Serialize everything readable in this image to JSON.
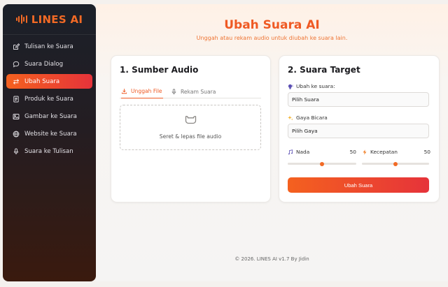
{
  "app": {
    "brand": "LINES AI",
    "accent": "#ef5a24"
  },
  "sidebar": {
    "items": [
      {
        "label": "Tulisan ke Suara",
        "icon": "edit-icon",
        "active": false
      },
      {
        "label": "Suara Dialog",
        "icon": "chat-bubble-icon",
        "active": false
      },
      {
        "label": "Ubah Suara",
        "icon": "swap-icon",
        "active": true
      },
      {
        "label": "Produk ke Suara",
        "icon": "document-icon",
        "active": false
      },
      {
        "label": "Gambar ke Suara",
        "icon": "image-icon",
        "active": false
      },
      {
        "label": "Website ke Suara",
        "icon": "globe-icon",
        "active": false
      },
      {
        "label": "Suara ke Tulisan",
        "icon": "microphone-icon",
        "active": false
      }
    ]
  },
  "header": {
    "title": "Ubah Suara AI",
    "subtitle": "Unggah atau rekam audio untuk diubah ke suara lain."
  },
  "source": {
    "title": "1. Sumber Audio",
    "tabs": [
      {
        "label": "Unggah File",
        "icon": "download-icon",
        "active": true
      },
      {
        "label": "Rekam Suara",
        "icon": "microphone-icon",
        "active": false
      }
    ],
    "dropzone_text": "Seret & lepas file audio"
  },
  "target": {
    "title": "2. Suara Target",
    "voice_label": "Ubah ke suara:",
    "voice_value": "Pilih Suara",
    "style_label": "Gaya Bicara",
    "style_value": "Pilih Gaya",
    "pitch": {
      "label": "Nada",
      "value": 50,
      "min": 0,
      "max": 100
    },
    "speed": {
      "label": "Kecepatan",
      "value": 50,
      "min": 0,
      "max": 100
    },
    "submit_label": "Ubah Suara"
  },
  "footer": {
    "text": "© 2026. LINES AI v1.7 By Jidin"
  }
}
